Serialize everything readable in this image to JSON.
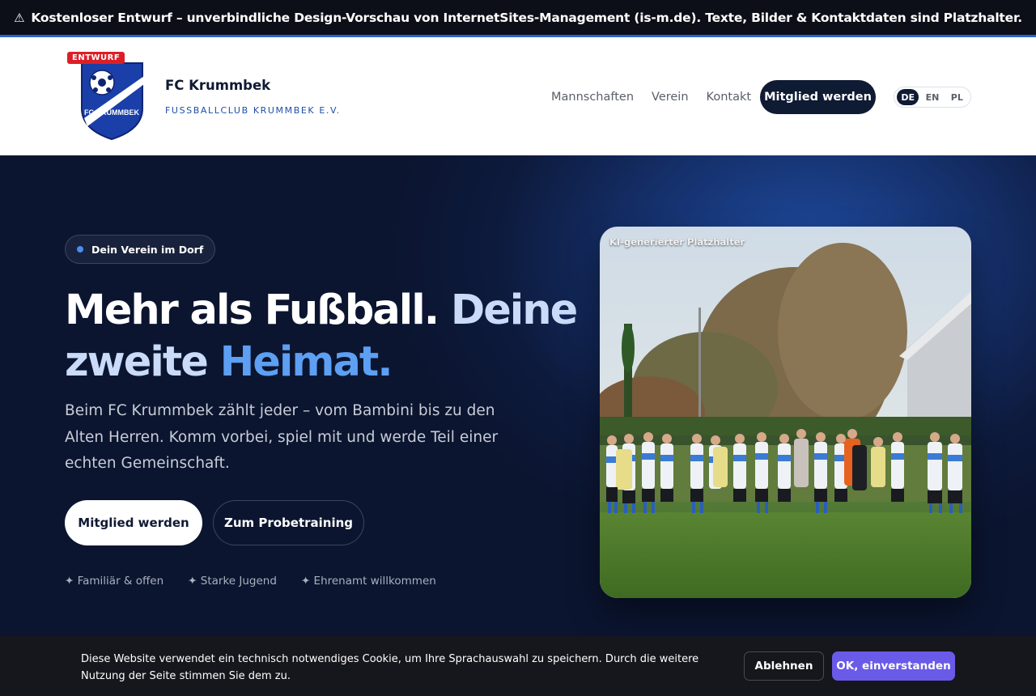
{
  "notice": {
    "icon": "warning-icon",
    "text": "Kostenloser Entwurf – unverbindliche Design-Vorschau von InternetSites-Management (is-m.de). Texte, Bilder & Kontaktdaten sind Platzhalter."
  },
  "header": {
    "badge": "ENTWURF",
    "logo_text": "FC KRUMMBEK",
    "brand_name": "FC Krummbek",
    "brand_sub": "FUSSBALLCLUB KRUMMBEK E.V.",
    "nav": [
      "Mannschaften",
      "Verein",
      "Kontakt"
    ],
    "cta": "Mitglied werden",
    "languages": [
      "DE",
      "EN",
      "PL"
    ],
    "active_language": "DE"
  },
  "hero": {
    "pill": "Dein Verein im Dorf",
    "title_part1": "Mehr als Fußball.",
    "title_part2": "Deine zweite",
    "title_part3": "Heimat.",
    "lead": "Beim FC Krummbek zählt jeder – vom Bambini bis zu den Alten Herren. Komm vorbei, spiel mit und werde Teil einer echten Gemeinschaft.",
    "primary_button": "Mitglied werden",
    "secondary_button": "Zum Probetraining",
    "features": [
      "✦ Familiär & offen",
      "✦ Starke Jugend",
      "✦ Ehrenamt willkommen"
    ],
    "photo_label": "KI-generierter Platzhalter"
  },
  "cookie": {
    "text": "Diese Website verwendet ein technisch notwendiges Cookie, um Ihre Sprachauswahl zu speichern. Durch die weitere Nutzung der Seite stimmen Sie dem zu.",
    "decline": "Ablehnen",
    "accept": "OK, einverstanden"
  },
  "colors": {
    "brand_dark": "#0f1a33",
    "accent_blue": "#5d9ff2",
    "badge_red": "#dc1f26",
    "cookie_accept": "#6a5ae8"
  }
}
